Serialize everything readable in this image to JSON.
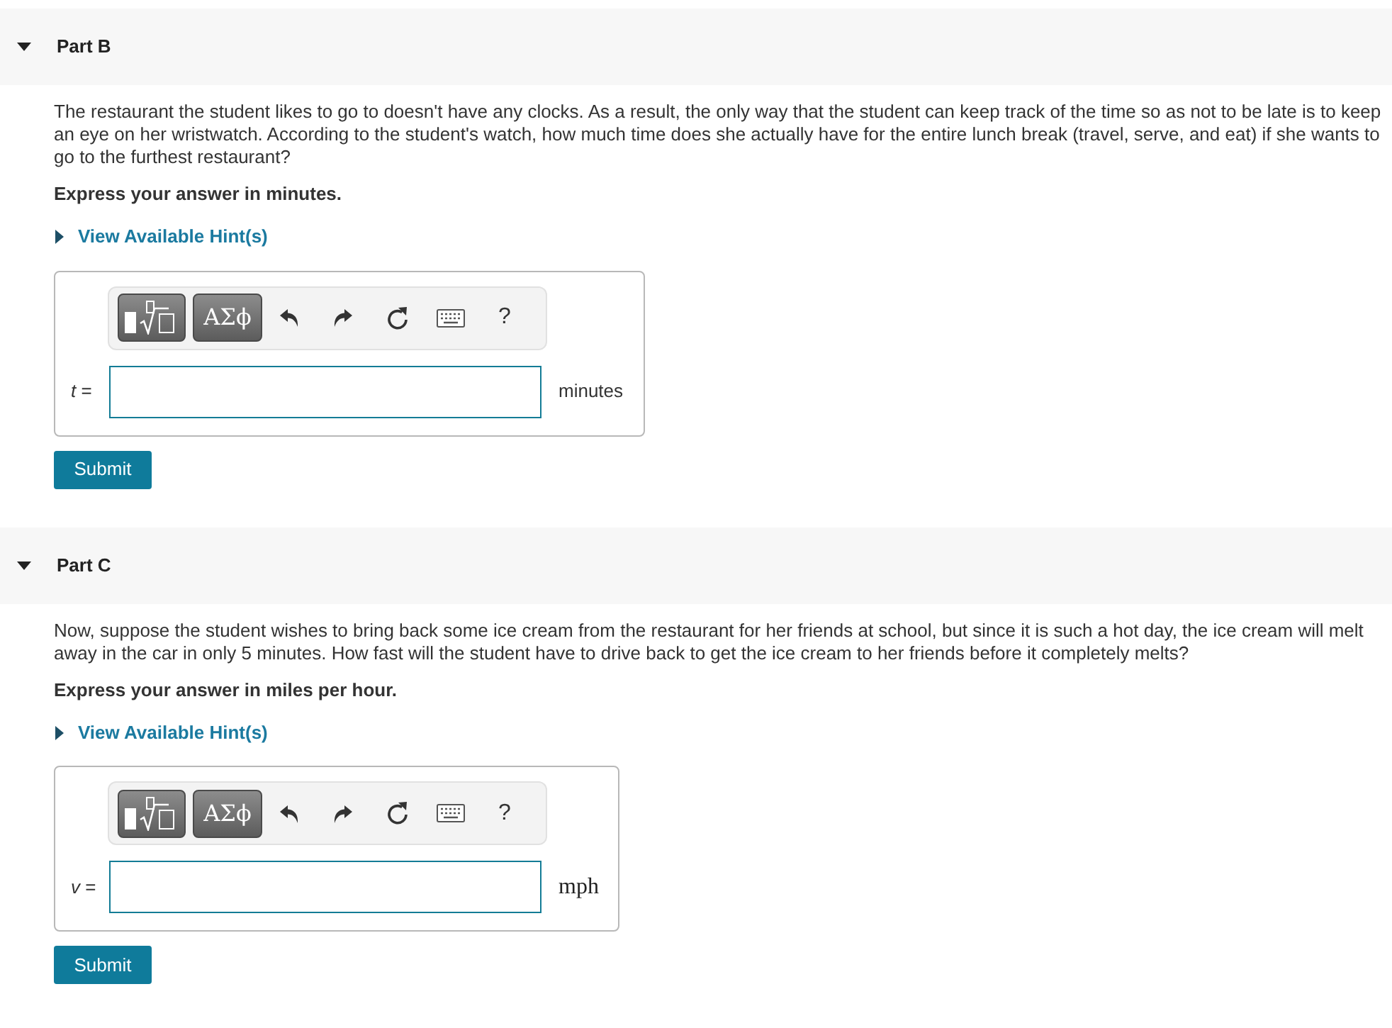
{
  "parts": [
    {
      "title": "Part B",
      "expanded": true,
      "question": "The restaurant the student likes to go to doesn't have any clocks. As a result, the only way that the student can keep track of the time so as not to be late is to keep an eye on her wristwatch. According to the student's watch, how much time does she actually have for the entire lunch break (travel, serve, and eat) if she wants to go to the furthest restaurant?",
      "instruction": "Express your answer in minutes.",
      "hint": {
        "label": "View Available Hint(s)",
        "expanded": false
      },
      "toolbar": {
        "symbols_button": "ΑΣϕ",
        "help_button": "?"
      },
      "answer": {
        "label": "*t* =",
        "unit": "minutes",
        "kind": "text"
      },
      "submit": "Submit"
    },
    {
      "title": "Part C",
      "expanded": true,
      "question": "Now, suppose the student wishes to bring back some ice cream from the restaurant for her friends at school, but since it is such a hot day, the ice cream will melt away in the car in only 5 minutes. How fast will the student have to drive back to get the ice cream to her friends before it completely melts?",
      "instruction": "Express your answer in miles per hour.",
      "hint": {
        "label": "View Available Hint(s)",
        "expanded": false
      },
      "toolbar": {
        "symbols_button": "ΑΣϕ",
        "help_button": "?"
      },
      "answer": {
        "label": "*v* =",
        "unit": "mph",
        "kind": "math"
      },
      "submit": "Submit"
    }
  ]
}
